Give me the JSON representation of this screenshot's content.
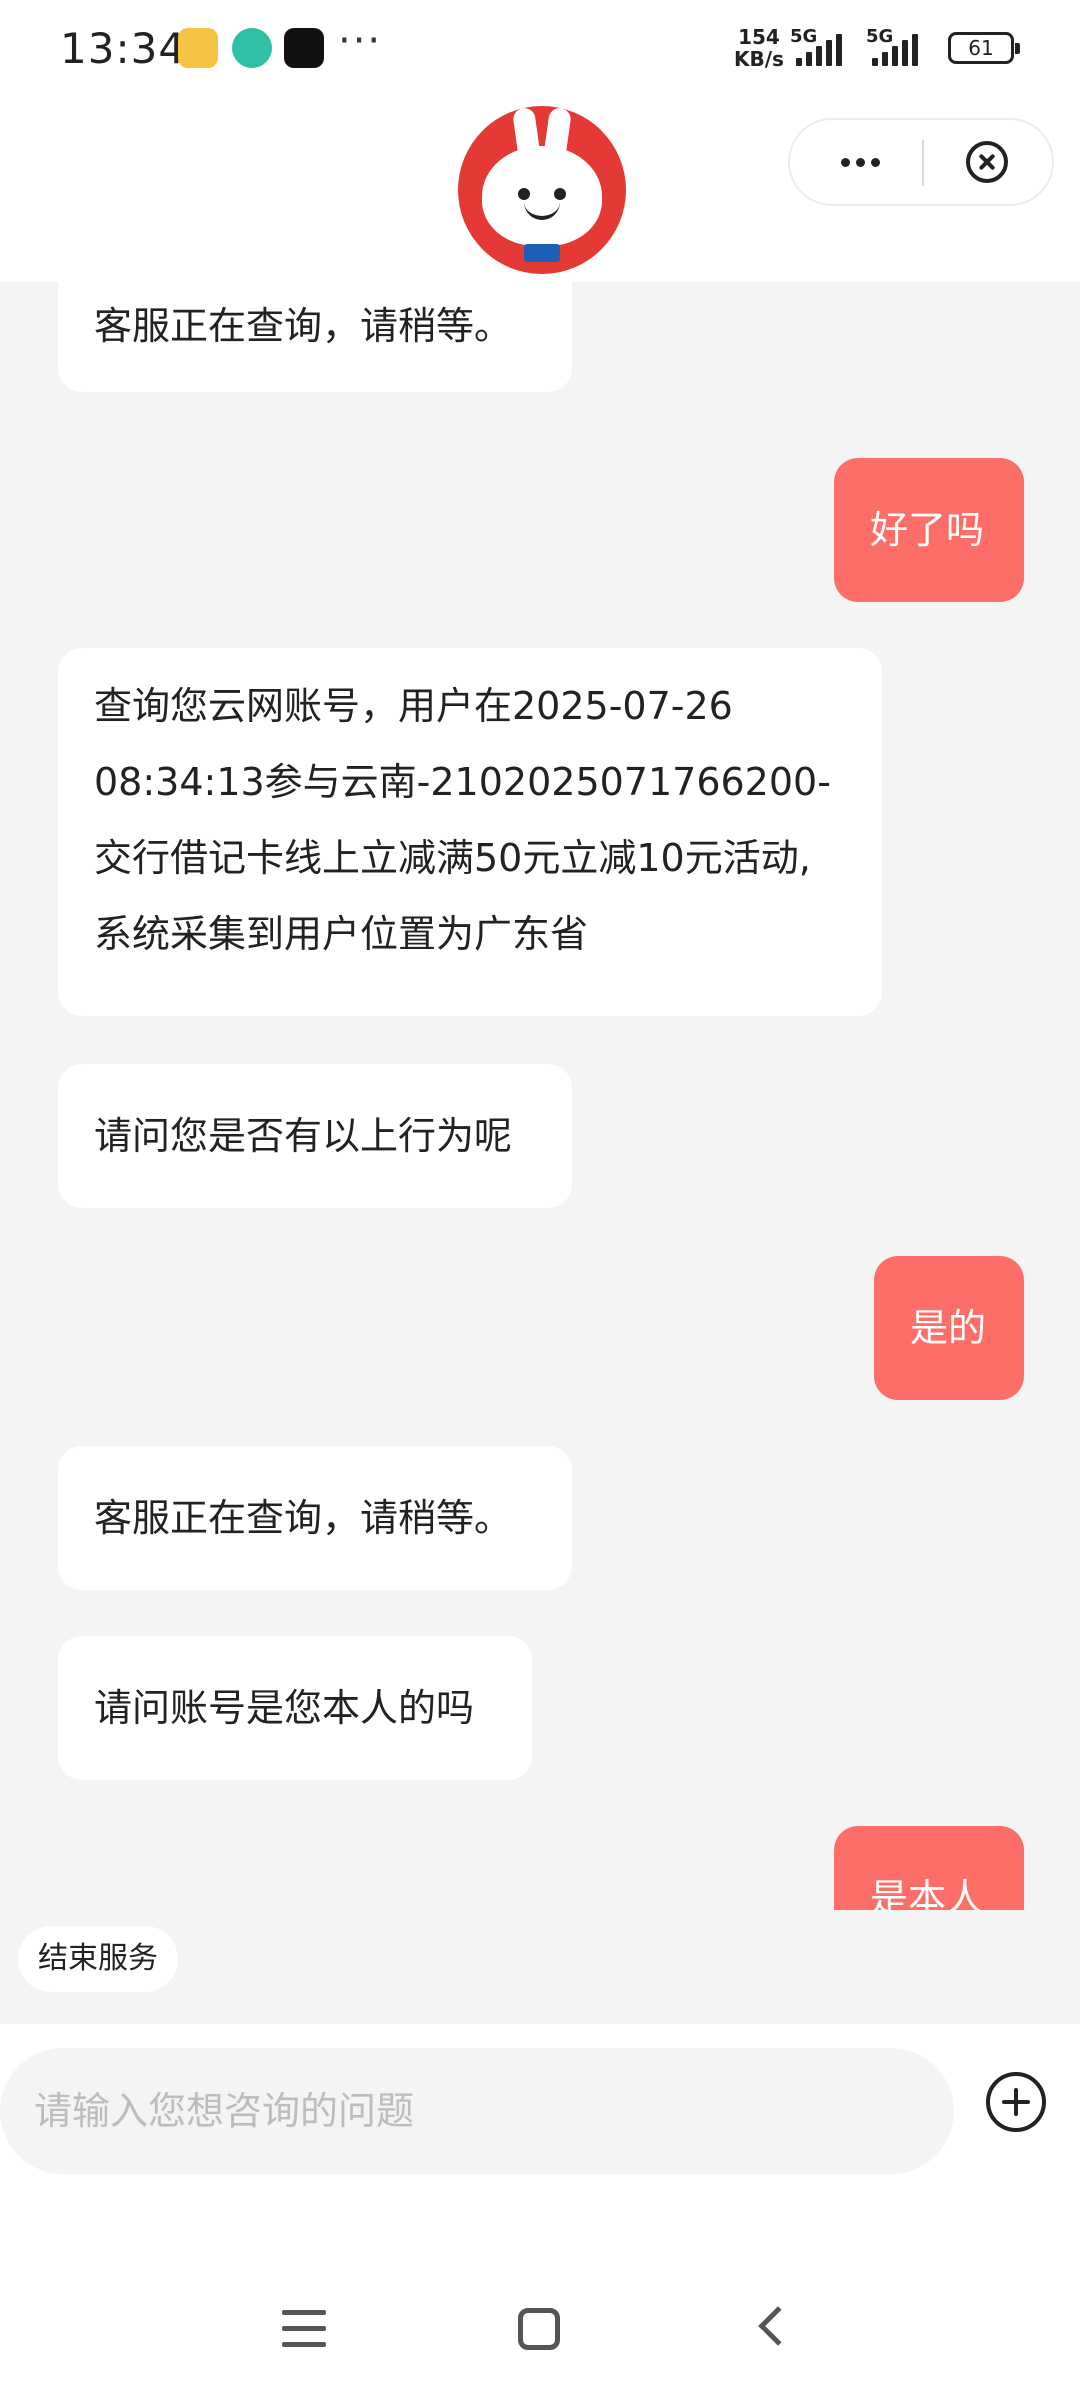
{
  "status_bar": {
    "time": "13:34",
    "net_speed_value": "154",
    "net_speed_unit": "KB/s",
    "signal1_label": "5G",
    "signal2_label": "5G",
    "battery": "61",
    "more_notifications": "···"
  },
  "header": {
    "avatar_icon": "bunny-mascot-avatar",
    "more_icon": "more-dots-icon",
    "close_icon": "close-circle-icon"
  },
  "messages": [
    {
      "role": "bot",
      "text": "客服正在查询，请稍等。"
    },
    {
      "role": "user",
      "text": "好了吗"
    },
    {
      "role": "bot",
      "lines": [
        "查询您云网账号，用户在2025-07-26",
        "08:34:13参与云南-2102025071766200-",
        "交行借记卡线上立减满50元立减10元活动,",
        "系统采集到用户位置为广东省"
      ]
    },
    {
      "role": "bot",
      "text": "请问您是否有以上行为呢"
    },
    {
      "role": "user",
      "text": "是的"
    },
    {
      "role": "bot",
      "text": "客服正在查询，请稍等。"
    },
    {
      "role": "bot",
      "text": "请问账号是您本人的吗"
    },
    {
      "role": "user",
      "text": "是本人"
    }
  ],
  "end_service_label": "结束服务",
  "input": {
    "placeholder": "请输入您想咨询的问题",
    "value": ""
  },
  "colors": {
    "user_bubble": "#fe6e69",
    "bot_bubble": "#ffffff",
    "chat_background": "#f4f4f4"
  }
}
